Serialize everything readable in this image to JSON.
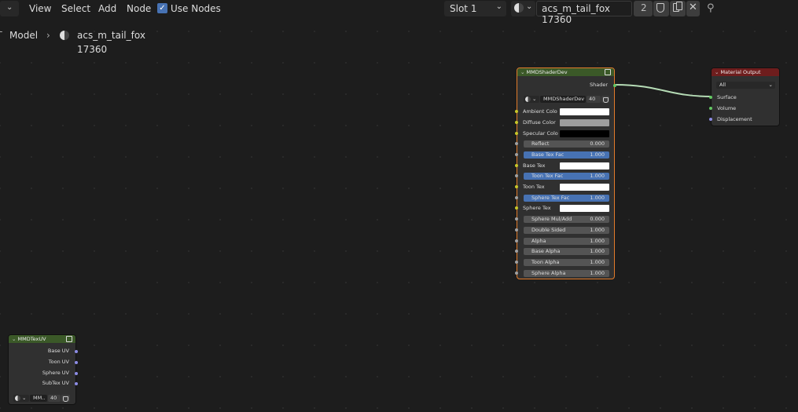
{
  "header": {
    "menus": [
      "View",
      "Select",
      "Add",
      "Node"
    ],
    "use_nodes_label": "Use Nodes",
    "slot_label": "Slot 1",
    "material_name": "acs_m_tail_fox 17360",
    "user_count": "2"
  },
  "breadcrumb": {
    "object": "Model",
    "material": "acs_m_tail_fox 17360"
  },
  "shader_node": {
    "title": "MMDShaderDev",
    "output_label": "Shader",
    "group_name": "MMDShaderDev",
    "group_users": "40",
    "ambient_label": "Ambient Colo",
    "diffuse_label": "Diffuse Color",
    "specular_label": "Specular Colo",
    "reflect_label": "Reflect",
    "reflect_value": "0.000",
    "base_tex_fac_label": "Base Tex Fac",
    "base_tex_fac_value": "1.000",
    "base_tex_label": "Base Tex",
    "toon_tex_fac_label": "Toon Tex Fac",
    "toon_tex_fac_value": "1.000",
    "toon_tex_label": "Toon Tex",
    "sphere_tex_fac_label": "Sphere Tex Fac",
    "sphere_tex_fac_value": "1.000",
    "sphere_tex_label": "Sphere Tex",
    "sphere_muladd_label": "Sphere Mul/Add",
    "sphere_muladd_value": "0.000",
    "double_sided_label": "Double Sided",
    "double_sided_value": "1.000",
    "alpha_label": "Alpha",
    "alpha_value": "1.000",
    "base_alpha_label": "Base Alpha",
    "base_alpha_value": "1.000",
    "toon_alpha_label": "Toon Alpha",
    "toon_alpha_value": "1.000",
    "sphere_alpha_label": "Sphere Alpha",
    "sphere_alpha_value": "1.000"
  },
  "output_node": {
    "title": "Material Output",
    "target": "All",
    "surface_label": "Surface",
    "volume_label": "Volume",
    "displacement_label": "Displacement"
  },
  "texuv_node": {
    "title": "MMDTexUV",
    "outputs": [
      "Base UV",
      "Toon UV",
      "Sphere UV",
      "SubTex UV"
    ],
    "group_name": "MM..",
    "group_users": "40"
  },
  "colors": {
    "group_header": "#3b5928",
    "output_header": "#6e1d1d",
    "active_border": "#e27b2a",
    "link": "#b6dcb6",
    "accent_blue": "#4772b3"
  }
}
